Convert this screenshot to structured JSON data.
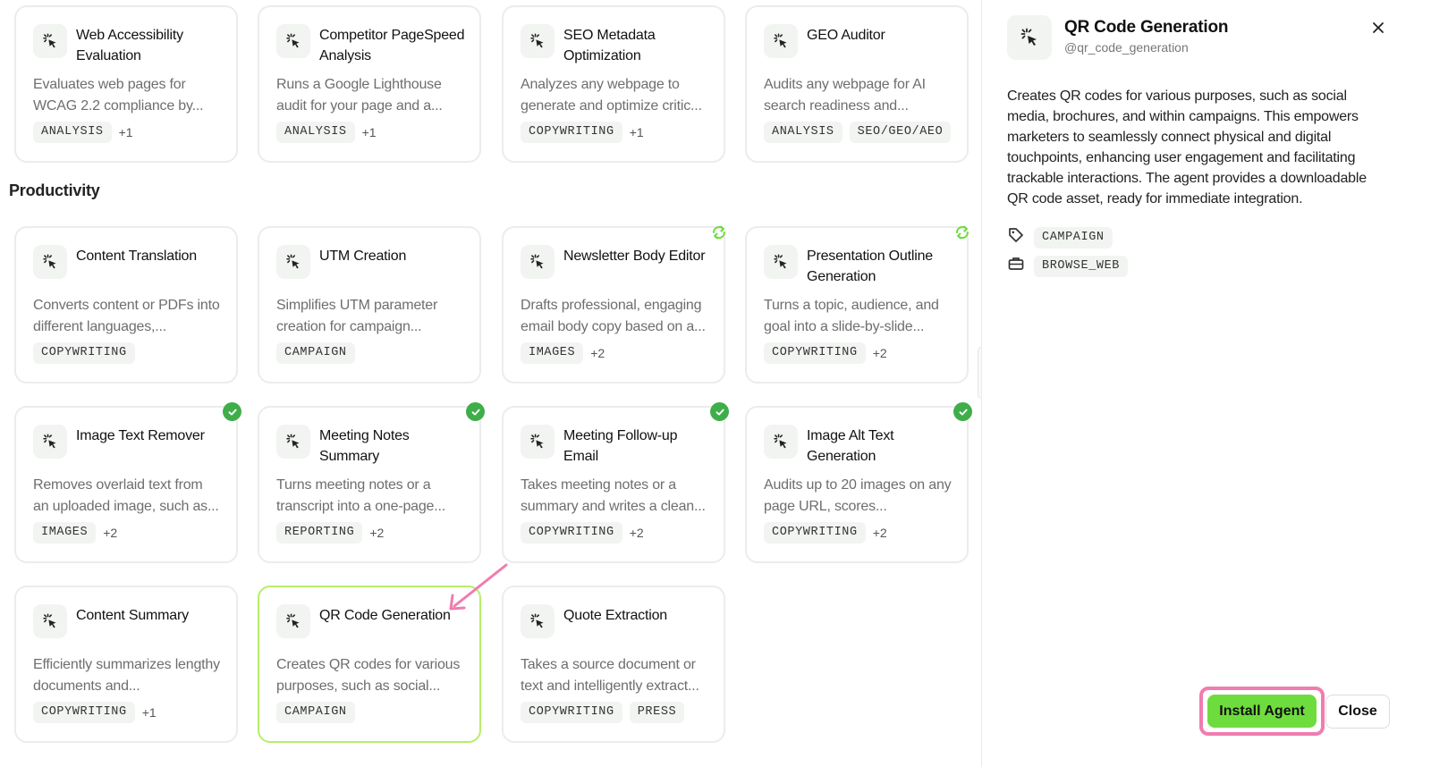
{
  "sections": {
    "productivity": "Productivity"
  },
  "cards": [
    {
      "title": "Web Accessibility Evaluation",
      "desc": "Evaluates web pages for WCAG 2.2 compliance by...",
      "tags": [
        "ANALYSIS"
      ],
      "more": "+1",
      "status": ""
    },
    {
      "title": "Competitor PageSpeed Analysis",
      "desc": "Runs a Google Lighthouse audit for your page and a...",
      "tags": [
        "ANALYSIS"
      ],
      "more": "+1",
      "status": ""
    },
    {
      "title": "SEO Metadata Optimization",
      "desc": "Analyzes any webpage to generate and optimize critic...",
      "tags": [
        "COPYWRITING"
      ],
      "more": "+1",
      "status": ""
    },
    {
      "title": "GEO Auditor",
      "desc": "Audits any webpage for AI search readiness and...",
      "tags": [
        "ANALYSIS",
        "SEO/GEO/AEO"
      ],
      "more": "",
      "status": ""
    },
    {
      "title": "Content Translation",
      "desc": "Converts content or PDFs into different languages,...",
      "tags": [
        "COPYWRITING"
      ],
      "more": "",
      "status": ""
    },
    {
      "title": "UTM Creation",
      "desc": "Simplifies UTM parameter creation for campaign...",
      "tags": [
        "CAMPAIGN"
      ],
      "more": "",
      "status": ""
    },
    {
      "title": "Newsletter Body Editor",
      "desc": "Drafts professional, engaging email body copy based on a...",
      "tags": [
        "IMAGES"
      ],
      "more": "+2",
      "status": "sync"
    },
    {
      "title": "Presentation Outline Generation",
      "desc": "Turns a topic, audience, and goal into a slide-by-slide...",
      "tags": [
        "COPYWRITING"
      ],
      "more": "+2",
      "status": "sync"
    },
    {
      "title": "Image Text Remover",
      "desc": "Removes overlaid text from an uploaded image, such as...",
      "tags": [
        "IMAGES"
      ],
      "more": "+2",
      "status": "installed"
    },
    {
      "title": "Meeting Notes Summary",
      "desc": "Turns meeting notes or a transcript into a one-page...",
      "tags": [
        "REPORTING"
      ],
      "more": "+2",
      "status": "installed"
    },
    {
      "title": "Meeting Follow-up Email",
      "desc": "Takes meeting notes or a summary and writes a clean...",
      "tags": [
        "COPYWRITING"
      ],
      "more": "+2",
      "status": "installed"
    },
    {
      "title": "Image Alt Text Generation",
      "desc": "Audits up to 20 images on any page URL, scores...",
      "tags": [
        "COPYWRITING"
      ],
      "more": "+2",
      "status": "installed"
    },
    {
      "title": "Content Summary",
      "desc": "Efficiently summarizes lengthy documents and...",
      "tags": [
        "COPYWRITING"
      ],
      "more": "+1",
      "status": ""
    },
    {
      "title": "QR Code Generation",
      "desc": "Creates QR codes for various purposes, such as social...",
      "tags": [
        "CAMPAIGN"
      ],
      "more": "",
      "status": "selected"
    },
    {
      "title": "Quote Extraction",
      "desc": "Takes a source document or text and intelligently extract...",
      "tags": [
        "COPYWRITING",
        "PRESS"
      ],
      "more": "",
      "status": ""
    }
  ],
  "panel": {
    "title": "QR Code Generation",
    "handle": "@qr_code_generation",
    "description": "Creates QR codes for various purposes, such as social media, brochures, and within campaigns. This empowers marketers to seamlessly connect physical and digital touchpoints, enhancing user engagement and facilitating trackable interactions. The agent provides a downloadable QR code asset, ready for immediate integration.",
    "category_tag": "CAMPAIGN",
    "tool_tag": "BROWSE_WEB",
    "install_label": "Install Agent",
    "close_label": "Close"
  },
  "colors": {
    "accent_green": "#6fdc3e",
    "installed_green": "#3fae4a",
    "highlight_ring": "#f07cb0",
    "selected_border": "#b7ee6b"
  },
  "icons": {
    "card_icon": "sparkle-cursor-icon",
    "close": "close-icon",
    "tag": "tag-icon",
    "tool": "toolbox-icon",
    "check": "check-icon",
    "sync": "sync-icon"
  }
}
